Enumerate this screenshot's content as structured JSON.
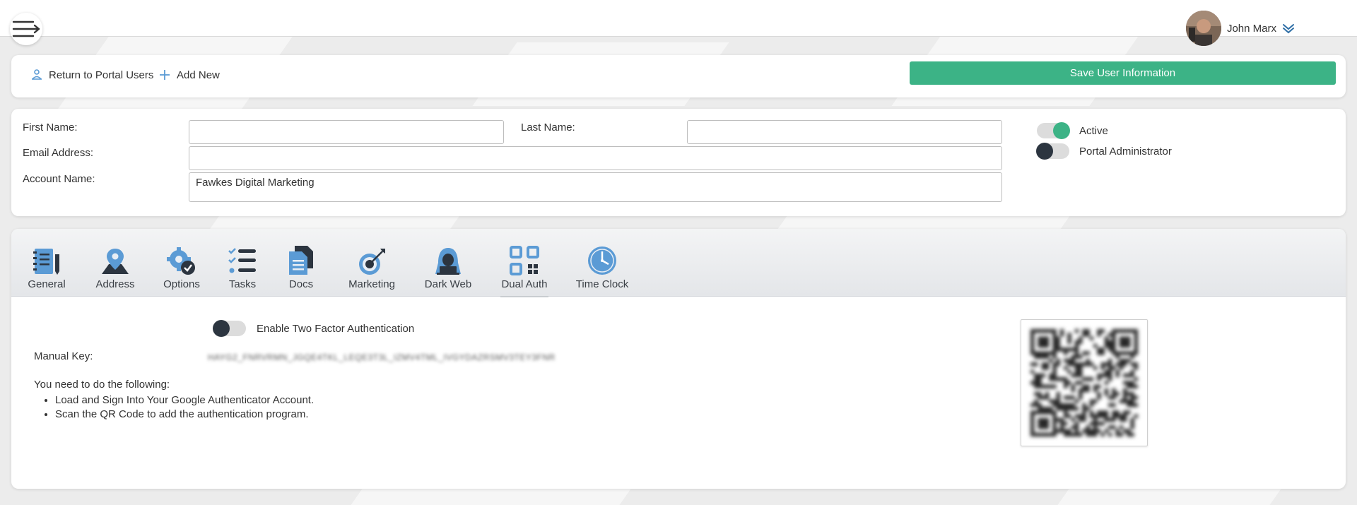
{
  "user": {
    "name": "John Marx"
  },
  "toolbar": {
    "return_label": "Return to Portal Users",
    "add_new_label": "Add New",
    "save_label": "Save User Information"
  },
  "form": {
    "first_name_label": "First Name:",
    "first_name_value": "",
    "last_name_label": "Last Name:",
    "last_name_value": "",
    "email_label": "Email Address:",
    "email_value": "",
    "account_label": "Account Name:",
    "account_value": "Fawkes Digital Marketing",
    "active_label": "Active",
    "active_on": true,
    "admin_label": "Portal Administrator",
    "admin_on": false
  },
  "tabs": [
    {
      "label": "General",
      "icon": "notebook-icon"
    },
    {
      "label": "Address",
      "icon": "map-pin-icon"
    },
    {
      "label": "Options",
      "icon": "gear-check-icon"
    },
    {
      "label": "Tasks",
      "icon": "checklist-icon"
    },
    {
      "label": "Docs",
      "icon": "documents-icon"
    },
    {
      "label": "Marketing",
      "icon": "target-icon"
    },
    {
      "label": "Dark Web",
      "icon": "hacker-icon"
    },
    {
      "label": "Dual Auth",
      "icon": "qr-code-icon"
    },
    {
      "label": "Time Clock",
      "icon": "clock-icon"
    }
  ],
  "dual_auth": {
    "enable_label": "Enable Two Factor Authentication",
    "enable_on": false,
    "manual_key_label": "Manual Key:",
    "manual_key_value": "HAYG2_FNRVRMN_JGQE4TKL_LEQE3T3L_IZMV4TML_IVGYDAZRSMV3TEY3FNR",
    "instructions_title": "You need to do the following:",
    "steps": [
      "Load and Sign Into Your Google Authenticator Account.",
      "Scan the QR Code to add the authentication program."
    ]
  },
  "colors": {
    "accent": "#3cb386",
    "dark": "#2c3540",
    "icon_blue": "#5b9bd5"
  }
}
